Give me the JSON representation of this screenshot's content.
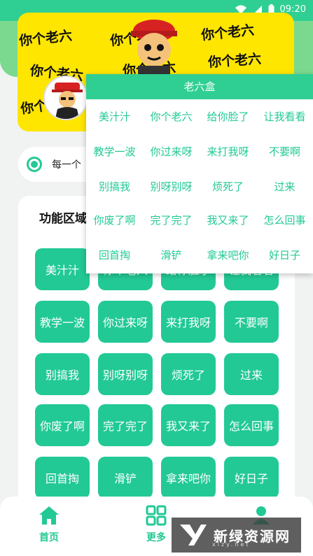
{
  "status_bar": {
    "time": "09:20",
    "icons": [
      "wifi-icon",
      "signal-icon",
      "battery-icon"
    ]
  },
  "banner": {
    "words": [
      "你个老六",
      "你个老六",
      "你个老六",
      "你个老六",
      "你个老六",
      "你个老六",
      "你个老六"
    ]
  },
  "notice": {
    "text": "每一个"
  },
  "function_area": {
    "title": "功能区域",
    "buttons": [
      "美汁汁",
      "你个老六",
      "给你脸了",
      "让我看看",
      "教学一波",
      "你过来呀",
      "来打我呀",
      "不要啊",
      "别搞我",
      "别呀别呀",
      "烦死了",
      "过来",
      "你废了啊",
      "完了完了",
      "我又来了",
      "怎么回事",
      "回首掏",
      "滑铲",
      "拿来吧你",
      "好日子"
    ]
  },
  "popup": {
    "title": "老六盒",
    "items": [
      "美汁汁",
      "你个老六",
      "给你脸了",
      "让我看看",
      "教学一波",
      "你过来呀",
      "来打我呀",
      "不要啊",
      "别搞我",
      "别呀别呀",
      "烦死了",
      "过来",
      "你废了啊",
      "完了完了",
      "我又来了",
      "怎么回事",
      "回首掏",
      "滑铲",
      "拿来吧你",
      "好日子"
    ]
  },
  "bottom_nav": [
    {
      "label": "首页",
      "icon": "home-icon"
    },
    {
      "label": "更多",
      "icon": "apps-icon"
    },
    {
      "label": "",
      "icon": "user-icon"
    }
  ],
  "watermark": {
    "text": "新绿资源网",
    "url": "xlzy.net"
  },
  "colors": {
    "primary": "#22c995",
    "header": "#2fcf93",
    "banner": "#ffe600"
  }
}
